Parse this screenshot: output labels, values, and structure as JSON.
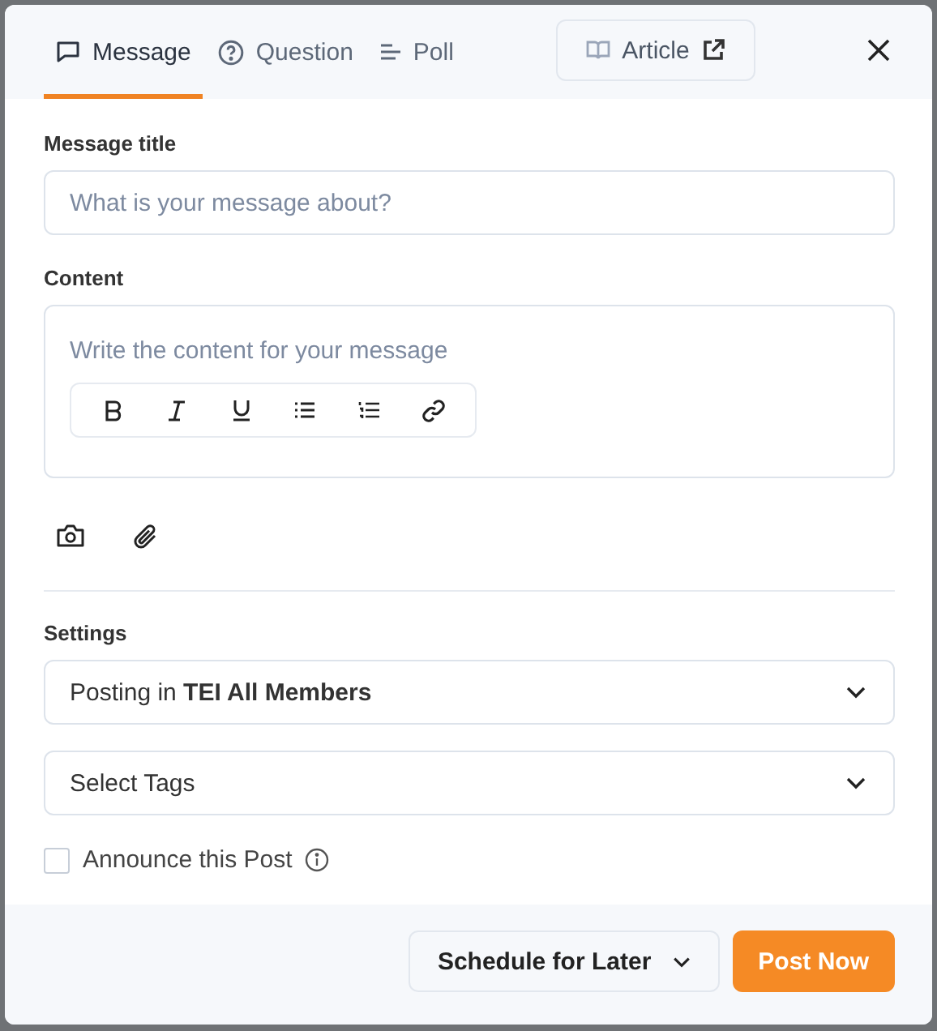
{
  "tabs": [
    {
      "label": "Message",
      "kind": "message",
      "selected": true
    },
    {
      "label": "Question",
      "kind": "question",
      "selected": false
    },
    {
      "label": "Poll",
      "kind": "poll",
      "selected": false
    }
  ],
  "article_button": {
    "label": "Article"
  },
  "title_field": {
    "label": "Message title",
    "placeholder": "What is your message about?"
  },
  "content_field": {
    "label": "Content",
    "placeholder": "Write the content for your message",
    "toolbar": [
      {
        "kind": "bold"
      },
      {
        "kind": "italic"
      },
      {
        "kind": "underline"
      },
      {
        "kind": "bullet-list"
      },
      {
        "kind": "numbered-list"
      },
      {
        "kind": "link"
      }
    ]
  },
  "attachments": [
    {
      "kind": "camera"
    },
    {
      "kind": "paperclip"
    }
  ],
  "settings": {
    "label": "Settings",
    "posting_in": "Posting in **TEI All Members**",
    "tags_placeholder": "Select Tags",
    "announce": {
      "label": "Announce this Post",
      "checked": false
    }
  },
  "footer": {
    "schedule": "Schedule for Later",
    "post": "Post Now"
  }
}
